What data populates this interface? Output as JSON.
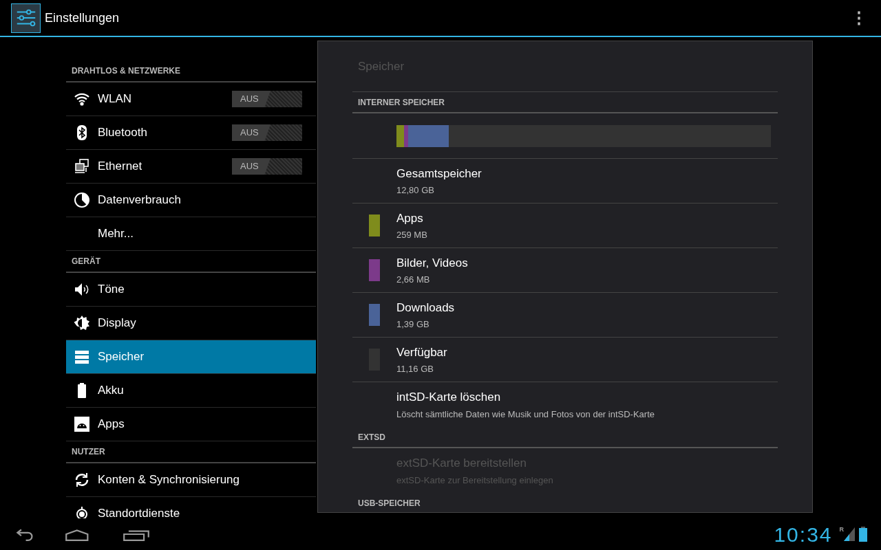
{
  "action_bar": {
    "title": "Einstellungen",
    "overflow_icon": "⋮"
  },
  "sidebar": {
    "sections": [
      {
        "header": "DRAHTLOS & NETZWERKE",
        "items": [
          {
            "label": "WLAN",
            "selected": false,
            "toggle": {
              "label": "AUS",
              "on": false
            }
          },
          {
            "label": "Bluetooth",
            "selected": false,
            "toggle": {
              "label": "AUS",
              "on": false
            }
          },
          {
            "label": "Ethernet",
            "selected": false,
            "toggle": {
              "label": "AUS",
              "on": false
            }
          },
          {
            "label": "Datenverbrauch",
            "selected": false
          },
          {
            "label": "Mehr...",
            "selected": false
          }
        ]
      },
      {
        "header": "GERÄT",
        "items": [
          {
            "label": "Töne",
            "selected": false
          },
          {
            "label": "Display",
            "selected": false
          },
          {
            "label": "Speicher",
            "selected": true
          },
          {
            "label": "Akku",
            "selected": false
          },
          {
            "label": "Apps",
            "selected": false
          }
        ]
      },
      {
        "header": "NUTZER",
        "items": [
          {
            "label": "Konten & Synchronisierung",
            "selected": false
          },
          {
            "label": "Standortdienste",
            "selected": false
          }
        ]
      }
    ]
  },
  "detail": {
    "title": "Speicher",
    "sections": [
      {
        "header": "INTERNER SPEICHER",
        "usage_bar": [
          {
            "color": "#7f8c1c",
            "level": 0.02
          },
          {
            "color": "#7c3a8a",
            "level": 0.011
          },
          {
            "color": "#4a6398",
            "level": 0.109
          }
        ],
        "items": [
          {
            "kind": "info",
            "title": "Gesamtspeicher",
            "summary": "12,80 GB"
          },
          {
            "kind": "usage",
            "title": "Apps",
            "summary": "259 MB",
            "color": "#7f8c1c"
          },
          {
            "kind": "usage",
            "title": "Bilder, Videos",
            "summary": "2,66 MB",
            "color": "#7c3a8a"
          },
          {
            "kind": "usage",
            "title": "Downloads",
            "summary": "1,39 GB",
            "color": "#4a6398"
          },
          {
            "kind": "usage",
            "title": "Verfügbar",
            "summary": "11,16 GB",
            "color": "#333333"
          },
          {
            "kind": "action",
            "title": "intSD-Karte löschen",
            "summary": "Löscht sämtliche Daten wie Musik und Fotos von der intSD-Karte",
            "disabled": false
          }
        ]
      },
      {
        "header": "EXTSD",
        "items": [
          {
            "kind": "action",
            "title": "extSD-Karte bereitstellen",
            "summary": "extSD-Karte zur Bereitstellung einlegen",
            "disabled": true
          }
        ]
      },
      {
        "header": "USB-SPEICHER"
      }
    ]
  },
  "status_bar": {
    "time": "10:34",
    "roaming": "R"
  }
}
